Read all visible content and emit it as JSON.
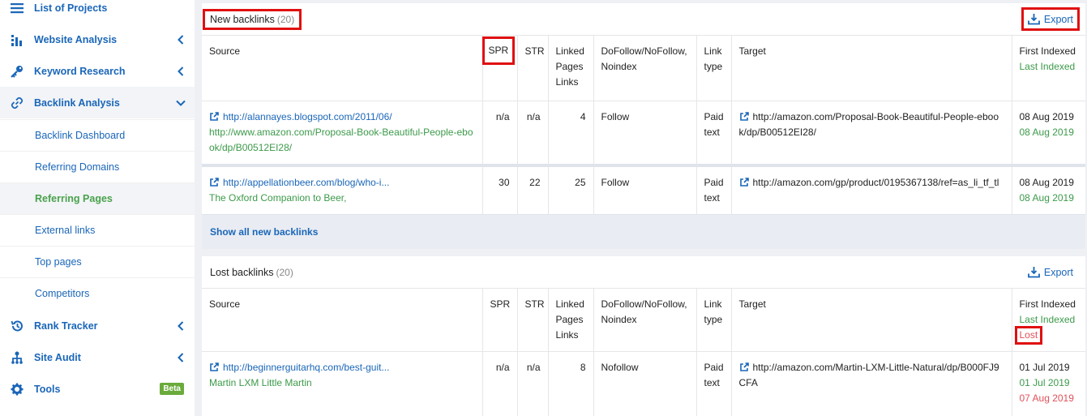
{
  "sidebar": {
    "items": [
      {
        "label": "List of Projects",
        "icon": "menu-icon"
      },
      {
        "label": "Website Analysis",
        "icon": "chart-icon"
      },
      {
        "label": "Keyword Research",
        "icon": "key-icon"
      },
      {
        "label": "Backlink Analysis",
        "icon": "link-icon"
      }
    ],
    "sub_items": [
      "Backlink Dashboard",
      "Referring Domains",
      "Referring Pages",
      "External links",
      "Top pages",
      "Competitors"
    ],
    "bottom_items": [
      {
        "label": "Rank Tracker",
        "icon": "history-icon"
      },
      {
        "label": "Site Audit",
        "icon": "sitemap-icon"
      },
      {
        "label": "Tools",
        "icon": "gear-icon",
        "badge": "Beta"
      }
    ]
  },
  "columns": {
    "source": "Source",
    "spr": "SPR",
    "str": "STR",
    "linked_pages": "Linked Pages Links",
    "dofollow": "DoFollow/NoFollow, Noindex",
    "link_type": "Link type",
    "target": "Target",
    "first_indexed": "First Indexed",
    "last_indexed": "Last Indexed",
    "lost": "Lost"
  },
  "new_backlinks": {
    "title": "New backlinks",
    "count": "(20)",
    "export_label": "Export",
    "rows": [
      {
        "source_url": "http://alannayes.blogspot.com/2011/06/",
        "source_anchor": "http://www.amazon.com/Proposal-Book-Beautiful-People-ebook/dp/B00512EI28/",
        "spr": "n/a",
        "str": "n/a",
        "linked": "4",
        "dofollow": "Follow",
        "link_type": "Paid text",
        "target": "http://amazon.com/Proposal-Book-Beautiful-People-ebook/dp/B00512EI28/",
        "first_indexed": "08 Aug 2019",
        "last_indexed": "08 Aug 2019"
      },
      {
        "source_url": "http://appellationbeer.com/blog/who-i...",
        "source_anchor": "The Oxford Companion to Beer,",
        "spr": "30",
        "str": "22",
        "linked": "25",
        "dofollow": "Follow",
        "link_type": "Paid text",
        "target": "http://amazon.com/gp/product/0195367138/ref=as_li_tf_tl",
        "first_indexed": "08 Aug 2019",
        "last_indexed": "08 Aug 2019"
      }
    ],
    "show_all": "Show all new backlinks"
  },
  "lost_backlinks": {
    "title": "Lost backlinks",
    "count": "(20)",
    "export_label": "Export",
    "rows": [
      {
        "source_url": "http://beginnerguitarhq.com/best-guit...",
        "source_anchor": "Martin LXM Little Martin",
        "spr": "n/a",
        "str": "n/a",
        "linked": "8",
        "dofollow": "Nofollow",
        "link_type": "Paid text",
        "target": "http://amazon.com/Martin-LXM-Little-Natural/dp/B000FJ9CFA",
        "first_indexed": "01 Jul 2019",
        "last_indexed": "01 Jul 2019",
        "lost": "07 Aug 2019"
      }
    ]
  },
  "colors": {
    "accent": "#1a66b8",
    "green": "#3c9a4a",
    "red": "#e0505a",
    "highlight": "#e01010"
  }
}
